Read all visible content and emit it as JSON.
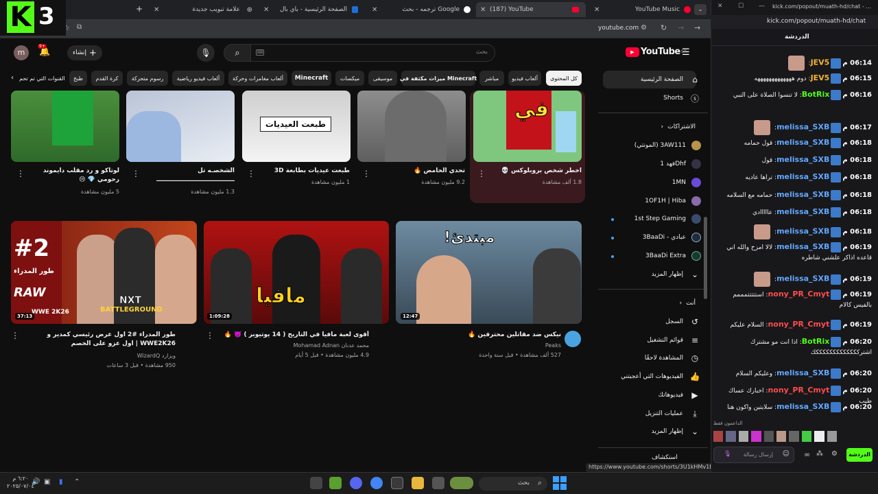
{
  "browser": {
    "tabs": [
      {
        "label": "YouTube Music"
      },
      {
        "label": "(187) YouTube"
      },
      {
        "label": "ترجمه - بحث Google"
      },
      {
        "label": "الصفحة الرئيسية - باي بال"
      },
      {
        "label": "علامة تبويب جديدة"
      }
    ],
    "url": "youtube.com",
    "chat_url": "kick.com/popout/muath-hd/chat",
    "window_title": "kick.com/popout/muath-hd/chat - G..."
  },
  "overlay": {
    "letter": "K",
    "number": "3"
  },
  "youtube": {
    "logo_text": "YouTube",
    "region": "SA",
    "search_placeholder": "بحث",
    "create_label": "إنشاء",
    "notif_count": "9+",
    "avatar_letter": "m",
    "chips": [
      "كل المحتوى",
      "ألعاب فيديو",
      "مباشر",
      "ميزات مكثفة في Minecraft",
      "موسيقى",
      "ميكسات",
      "Minecraft",
      "ألعاب مغامرات وحركة",
      "ألعاب فيديو رياضية",
      "رسوم متحركة",
      "كرة القدم",
      "طبخ",
      "القنوات التي تم تحم"
    ],
    "shorts_row": [
      {
        "title": "اخطر شخص بروبلوكس 💀",
        "views": "1.8 ألف مشاهدة"
      },
      {
        "title": "تحدي الحامض 🔥",
        "views": "9.2 مليون مشاهدة"
      },
      {
        "title": "طبعت عيديات بطابعة 3D",
        "views": "1 مليون مشاهدة"
      },
      {
        "title": "الشخصـه تل ـــــــــــــــــــــــــــــــــــــ",
        "views": "1.3 مليون مشاهدة"
      },
      {
        "title": "لوتاكو و رد مقلب دايموند رحومي 💎 😢",
        "views": "5 مليون مشاهدة"
      }
    ],
    "short_thumb_texts": {
      "fi": "في",
      "eidiyat": "طبعت العيديات"
    },
    "videos": [
      {
        "title": "نيكس ضد مقاتلين محترفين 🔥",
        "channel": "Peaks",
        "meta": "527 ألف مشاهدة • قبل سنة واحدة",
        "duration": "12:47",
        "thumb_text": "مبتدئ!"
      },
      {
        "title": "أقوى لعبة مافيا في التاريخ ( 14 يوتيوبر ) 👿 🔥",
        "channel": "محمد عدنان Mohamad Adnan",
        "meta": "4.9 مليون مشاهدة • قبل 5 أيام",
        "duration": "1:09:28",
        "thumb_text": "مافيا"
      },
      {
        "title": "طور المدراء #2 اول عرض رئيسي كمدير و WWE2K26 | اول عزو على الخصم",
        "channel": "ويزارد WizardQ",
        "meta": "950 مشاهدة • قبل 3 ساعات",
        "duration": "37:13",
        "thumb_text": "#2",
        "thumb_sub": "طور المدراء",
        "brand1": "RAW",
        "brand2": "NXT",
        "brand3": "BATTLEGROUND",
        "brand4": "WWE 2K26"
      }
    ],
    "sidebar": {
      "home": "الصفحة الرئيسية",
      "shorts": "Shorts",
      "subs_header": "الاشتراكات",
      "subscriptions": [
        "(المونتي) 3AW111",
        "فهد 1Dhf",
        "1MN",
        "1OF1H | Hiba",
        "1st Step Gaming",
        "3BaaDi - عبادي",
        "3BaaDi Extra"
      ],
      "show_more": "إظهار المزيد",
      "you_header": "أنت",
      "you_items": [
        "السجل",
        "قوائم التشغيل",
        "المشاهدة لاحقًا",
        "الفيديوهات التي أعجبتني",
        "فيديوهاتك",
        "عمليات التنزيل"
      ],
      "show_more2": "إظهار المزيد",
      "explore": "استكشاف"
    },
    "status_url": "https://www.youtube.com/shorts/3U1kHMv1Bew"
  },
  "chat": {
    "header": "الدردشة",
    "messages": [
      {
        "time": "06:14 م",
        "user": "JEV5",
        "color": "#f5b335",
        "text": ""
      },
      {
        "time": "06:15 م",
        "user": "JEV5",
        "color": "#f5b335",
        "text": "دوم هههههههههههههه"
      },
      {
        "time": "06:16 م",
        "user": "BotRix",
        "color": "#53fc18",
        "text": "لا تنسوا الصلاة على النبي"
      },
      {
        "time": "06:17 م",
        "user": "melissa_SXB",
        "color": "#62a8ff",
        "text": ""
      },
      {
        "time": "06:18 م",
        "user": "melissa_SXB",
        "color": "#62a8ff",
        "text": "قول حمامه"
      },
      {
        "time": "06:18 م",
        "user": "melissa_SXB",
        "color": "#62a8ff",
        "text": "قول"
      },
      {
        "time": "06:18 م",
        "user": "melissa_SXB",
        "color": "#62a8ff",
        "text": "تراها عاديه"
      },
      {
        "time": "06:18 م",
        "user": "melissa_SXB",
        "color": "#62a8ff",
        "text": "حمامه مع السلامه"
      },
      {
        "time": "06:18 م",
        "user": "melissa_SXB",
        "color": "#62a8ff",
        "text": "عااااادي"
      },
      {
        "time": "06:18 م",
        "user": "melissa_SXB",
        "color": "#62a8ff",
        "text": ""
      },
      {
        "time": "06:19 م",
        "user": "melissa_SXB",
        "color": "#62a8ff",
        "text": "لالا امزح والله اني قاعده اذاكر علشني شاطره"
      },
      {
        "time": "06:19 م",
        "user": "melissa_SXB",
        "color": "#62a8ff",
        "text": ""
      },
      {
        "time": "06:19 م",
        "user": "nony_PR_Cmyt",
        "color": "#ff4d4d",
        "text": "استتتتتمممم بالفيس كالام"
      },
      {
        "time": "06:19 م",
        "user": "nony_PR_Cmyt",
        "color": "#ff4d4d",
        "text": "السلام عليكم"
      },
      {
        "time": "06:20 م",
        "user": "BotRix",
        "color": "#53fc18",
        "text": "اذا انت مو مشترك اشتركككككككككككككك"
      },
      {
        "time": "06:20 م",
        "user": "melissa_SXB",
        "color": "#62a8ff",
        "text": "وعليكم السلام"
      },
      {
        "time": "06:20 م",
        "user": "nony_PR_Cmyt",
        "color": "#ff4d4d",
        "text": "اخبارك عساك طيب"
      },
      {
        "time": "06:20 م",
        "user": "melissa_SXB",
        "color": "#62a8ff",
        "text": "سلايتين واكون هنا"
      }
    ],
    "supporters_label": "الداعمون فقط",
    "input_placeholder": "إرسال رسالة",
    "send_label": "الدردشة"
  },
  "taskbar": {
    "search_placeholder": "بحث",
    "time": "٦:٢٠ م",
    "date": "٢٠٢٥/٠٧/٠٤"
  }
}
